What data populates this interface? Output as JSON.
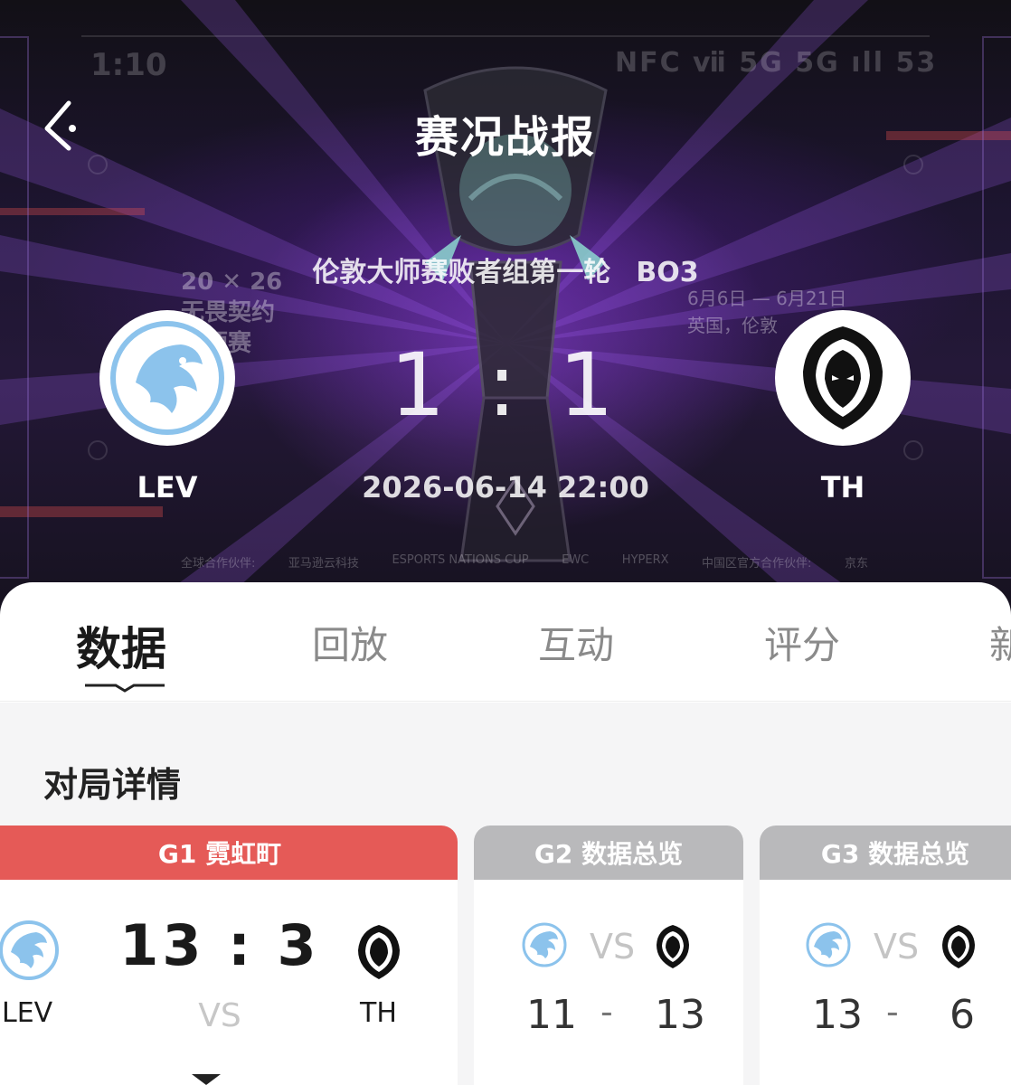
{
  "status_bar": {
    "time": "1:10",
    "indicators": "NFC ⅶ 5G 5G ıll 53"
  },
  "header": {
    "title": "赛况战报",
    "back_icon": "back-arrow-icon"
  },
  "match": {
    "stage": "伦敦大师赛败者组第一轮",
    "format": "BO3",
    "team_left": {
      "name": "LEV",
      "logo": "leviatan-dragon-logo",
      "color": "#8cc3ec"
    },
    "team_right": {
      "name": "TH",
      "logo": "team-heretics-hooded-logo",
      "color": "#111111"
    },
    "score": "1 : 1",
    "datetime": "2026-06-14 22:00"
  },
  "background": {
    "event_year_a": "20",
    "event_year_b": "26",
    "event_name_1": "无畏契约",
    "event_name_2": "大师赛",
    "event_dates": "6月6日 — 6月21日",
    "event_location": "英国，伦敦",
    "sponsor_label_global": "全球合作伙伴:",
    "sponsor_1": "亚马逊云科技",
    "sponsor_2": "ESPORTS NATIONS CUP",
    "sponsor_3": "EWC",
    "sponsor_4": "HYPERX",
    "sponsor_label_cn": "中国区官方合作伙伴:",
    "sponsor_5": "京东"
  },
  "tabs": [
    {
      "label": "数据",
      "active": true
    },
    {
      "label": "回放",
      "active": false
    },
    {
      "label": "互动",
      "active": false
    },
    {
      "label": "评分",
      "active": false
    },
    {
      "label": "新",
      "active": false
    }
  ],
  "section": {
    "title": "对局详情"
  },
  "games": [
    {
      "header": "G1 霓虹町",
      "left": "LEV",
      "right": "TH",
      "score": "13 : 3",
      "vs": "VS",
      "active": true,
      "color": "#e55a57"
    },
    {
      "header": "G2 数据总览",
      "vs": "VS",
      "score_left": "11",
      "sep": "-",
      "score_right": "13",
      "active": false
    },
    {
      "header": "G3 数据总览",
      "vs": "VS",
      "score_left": "13",
      "sep": "-",
      "score_right": "6",
      "active": false
    }
  ]
}
